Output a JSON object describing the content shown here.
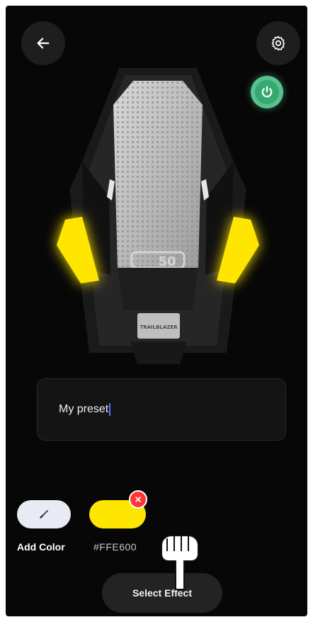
{
  "header": {
    "back_icon": "arrow-left-icon",
    "settings_icon": "gear-icon",
    "power_icon": "power-icon"
  },
  "device": {
    "model_label": "50",
    "plate_label": "TRAILBLAZER",
    "light_color": "#FFE600"
  },
  "preset": {
    "name_value": "My preset"
  },
  "colors": {
    "add_label": "Add Color",
    "swatches": [
      {
        "hex": "#FFE600",
        "label": "#FFE600"
      }
    ]
  },
  "actions": {
    "select_effect_label": "Select Effect"
  },
  "accent": {
    "power": "#35A96F",
    "remove": "#FF3535"
  }
}
